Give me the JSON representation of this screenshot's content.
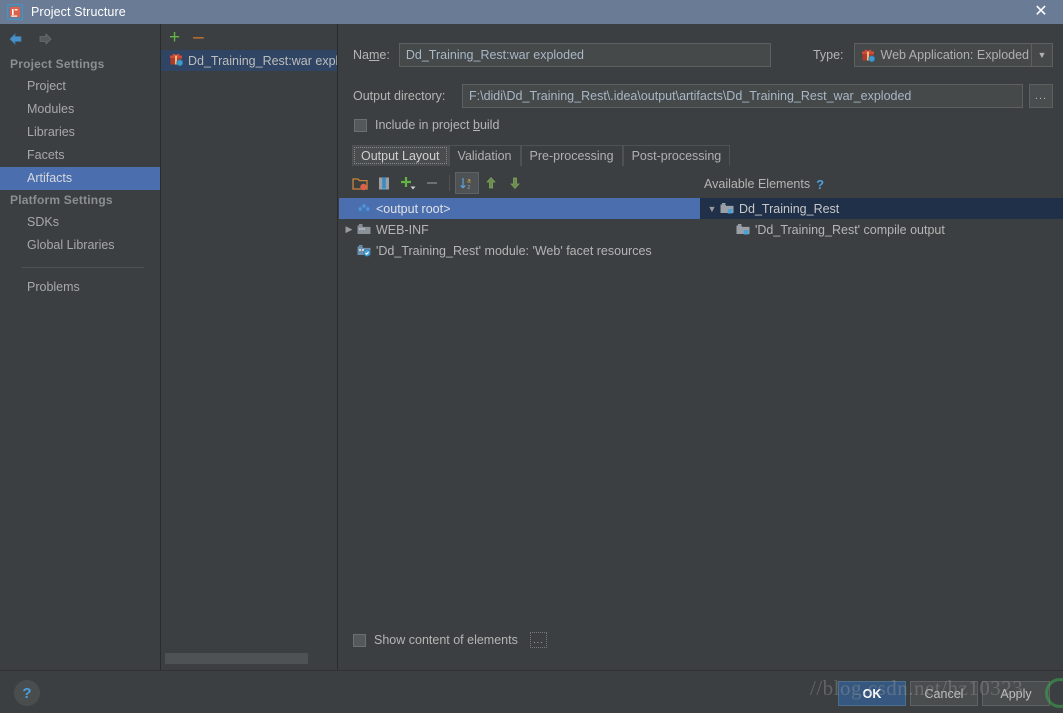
{
  "window": {
    "title": "Project Structure",
    "app_icon": "intellij-idea-icon",
    "close_label": "✕"
  },
  "nav": {
    "back_icon": "arrow-left-icon",
    "forward_icon": "arrow-right-icon"
  },
  "sidebar": {
    "sections": [
      {
        "label": "Project Settings",
        "items": [
          {
            "label": "Project",
            "selected": false
          },
          {
            "label": "Modules",
            "selected": false
          },
          {
            "label": "Libraries",
            "selected": false
          },
          {
            "label": "Facets",
            "selected": false
          },
          {
            "label": "Artifacts",
            "selected": true
          }
        ]
      },
      {
        "label": "Platform Settings",
        "items": [
          {
            "label": "SDKs",
            "selected": false
          },
          {
            "label": "Global Libraries",
            "selected": false
          }
        ]
      }
    ],
    "extra_items": [
      {
        "label": "Problems",
        "selected": false
      }
    ]
  },
  "artifacts_panel": {
    "toolbar": {
      "add_label": "+",
      "add_icon": "plus-icon",
      "remove_label": "–",
      "remove_icon": "minus-icon"
    },
    "items": [
      {
        "label": "Dd_Training_Rest:war exploded",
        "icon": "war-artifact-icon",
        "selected": true
      }
    ],
    "scrollbar": "horizontal-scrollbar"
  },
  "detail": {
    "name_label": "Name:",
    "name_value": "Dd_Training_Rest:war exploded",
    "name_placeholder": "",
    "type_label": "Type:",
    "type_value": "Web Application: Exploded",
    "type_icon": "web-artifact-icon",
    "type_arrow_icon": "chevron-down-icon",
    "output_dir_label": "Output directory:",
    "output_dir_value": "F:\\didi\\Dd_Training_Rest\\.idea\\output\\artifacts\\Dd_Training_Rest_war_exploded",
    "output_dir_browse_label": "...",
    "include_in_build_label": "Include in project build",
    "include_in_build_checked": false,
    "tabs": [
      {
        "label": "Output Layout",
        "active": true
      },
      {
        "label": "Validation",
        "active": false
      },
      {
        "label": "Pre-processing",
        "active": false
      },
      {
        "label": "Post-processing",
        "active": false
      }
    ],
    "layout_toolbar": [
      {
        "icon": "create-directory-icon",
        "enabled": true,
        "toggled": false
      },
      {
        "icon": "create-archive-icon",
        "enabled": true,
        "toggled": false
      },
      {
        "icon": "add-copy-icon",
        "enabled": true,
        "toggled": false
      },
      {
        "icon": "remove-icon",
        "enabled": false,
        "toggled": false
      },
      {
        "icon": "sort-alphabetically-icon",
        "enabled": true,
        "toggled": true
      },
      {
        "icon": "move-up-icon",
        "enabled": true,
        "toggled": false
      },
      {
        "icon": "move-down-icon",
        "enabled": true,
        "toggled": false
      }
    ],
    "output_tree": [
      {
        "label": "<output root>",
        "icon": "output-root-icon",
        "indent": 0,
        "twisty": "",
        "selected": true
      },
      {
        "label": "WEB-INF",
        "icon": "folder-icon",
        "indent": 1,
        "twisty": "▶",
        "selected": false
      },
      {
        "label": "'Dd_Training_Rest' module: 'Web' facet resources",
        "icon": "facet-resources-icon",
        "indent": 1,
        "twisty": "",
        "selected": false
      }
    ],
    "available_header": "Available Elements",
    "available_help_icon": "help-question-icon",
    "available_tree": [
      {
        "label": "Dd_Training_Rest",
        "icon": "module-icon",
        "indent": 0,
        "twisty": "▼",
        "selected": true
      },
      {
        "label": "'Dd_Training_Rest' compile output",
        "icon": "compile-output-icon",
        "indent": 1,
        "twisty": "",
        "selected": false
      }
    ],
    "show_content_label": "Show content of elements",
    "show_content_checked": false,
    "show_content_more_label": "..."
  },
  "footer": {
    "help_icon": "help-question-icon",
    "help_label": "?",
    "buttons": [
      {
        "label": "OK",
        "default": true
      },
      {
        "label": "Cancel",
        "default": false
      },
      {
        "label": "Apply",
        "default": false
      }
    ]
  },
  "watermark": {
    "text": "//blog.csdn.net/hz10323"
  }
}
